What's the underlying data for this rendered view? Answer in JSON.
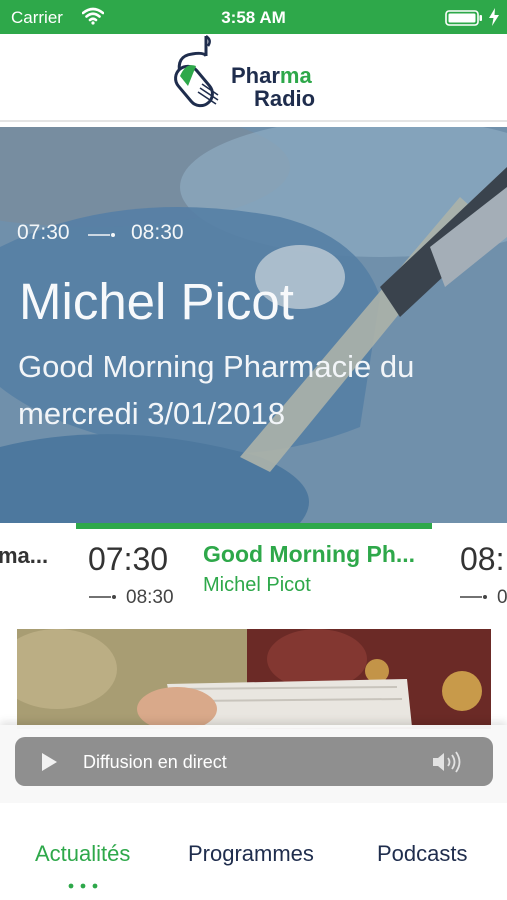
{
  "status_bar": {
    "carrier": "Carrier",
    "time": "3:58 AM"
  },
  "header": {
    "logo_line1_dark": "Pharma",
    "logo_line1_green": "ma",
    "logo_line1_prefix": "Phar",
    "logo_line2": "Radio"
  },
  "hero": {
    "start_time": "07:30",
    "end_time": "08:30",
    "host": "Michel Picot",
    "title": "Good Morning Pharmacie du mercredi 3/01/2018"
  },
  "schedule": {
    "previous_title": "ma...",
    "current": {
      "start": "07:30",
      "end": "08:30",
      "title": "Good Morning Ph...",
      "host": "Michel Picot"
    },
    "next": {
      "start": "08:",
      "end": "0"
    }
  },
  "player": {
    "label": "Diffusion en direct"
  },
  "tabs": [
    {
      "label": "Actualités",
      "active": true
    },
    {
      "label": "Programmes",
      "active": false
    },
    {
      "label": "Podcasts",
      "active": false
    }
  ],
  "colors": {
    "accent": "#2ea84a",
    "navy": "#1f2d4d",
    "player_bg": "#8f8f8f"
  }
}
